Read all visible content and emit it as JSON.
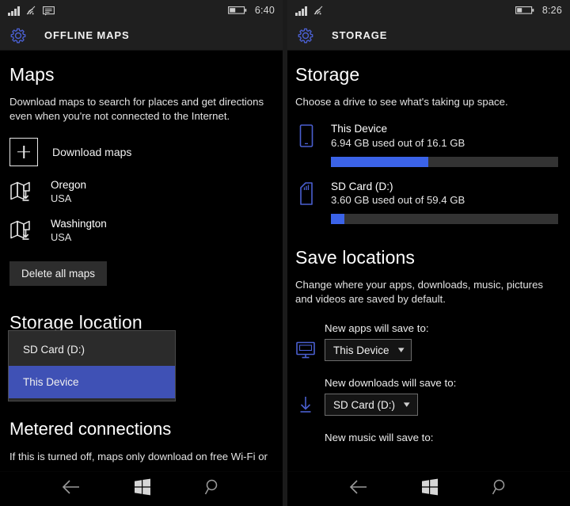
{
  "left": {
    "statusbar": {
      "signal_icon": "signal-bars-icon",
      "wifi_icon": "wifi-icon",
      "message_icon": "message-icon",
      "battery_icon": "battery-icon",
      "time": "6:40"
    },
    "appbar": {
      "gear_icon": "gear-icon",
      "title": "OFFLINE MAPS"
    },
    "heading": "Maps",
    "description": "Download maps to search for places and get directions even when you're not connected to the Internet.",
    "download_maps_label": "Download maps",
    "download_maps_icon": "plus-box-icon",
    "maps": [
      {
        "name": "Oregon",
        "region": "USA",
        "icon": "map-download-icon"
      },
      {
        "name": "Washington",
        "region": "USA",
        "icon": "map-download-icon"
      }
    ],
    "delete_all_label": "Delete all maps",
    "storage_location_heading": "Storage location",
    "flyout": {
      "options": [
        {
          "label": "SD Card (D:)",
          "selected": false
        },
        {
          "label": "This Device",
          "selected": true
        }
      ],
      "selected_color": "#3f51b5"
    },
    "metered": {
      "heading": "Metered connections",
      "description": "If this is turned off, maps only download on free Wi-Fi or"
    },
    "navbar": {
      "back_icon": "back-arrow-icon",
      "start_icon": "windows-start-icon",
      "search_icon": "search-icon"
    }
  },
  "right": {
    "statusbar": {
      "signal_icon": "signal-bars-icon",
      "wifi_icon": "wifi-icon",
      "battery_icon": "battery-icon",
      "time": "8:26"
    },
    "appbar": {
      "gear_icon": "gear-icon",
      "title": "STORAGE"
    },
    "heading": "Storage",
    "description": "Choose a drive to see what's taking up space.",
    "drives": [
      {
        "name": "This Device",
        "usage": "6.94 GB used out of 16.1 GB",
        "icon": "phone-icon",
        "percent": 43
      },
      {
        "name": "SD Card (D:)",
        "usage": "3.60 GB used out of 59.4 GB",
        "icon": "sd-card-icon",
        "percent": 6
      }
    ],
    "save_locations": {
      "heading": "Save locations",
      "description": "Change where your apps, downloads, music, pictures and videos are saved by default.",
      "rows": [
        {
          "caption": "New apps will save to:",
          "value": "This Device",
          "icon": "monitor-icon"
        },
        {
          "caption": "New downloads will save to:",
          "value": "SD Card (D:)",
          "icon": "download-arrow-icon"
        },
        {
          "caption": "New music will save to:",
          "value": "",
          "icon": "music-icon"
        }
      ]
    },
    "navbar": {
      "back_icon": "back-arrow-icon",
      "start_icon": "windows-start-icon",
      "search_icon": "search-icon"
    }
  },
  "theme": {
    "accent": "#3b63e8",
    "icon_blue": "#4a5fd0",
    "background": "#000000",
    "bar_track": "#333333"
  }
}
